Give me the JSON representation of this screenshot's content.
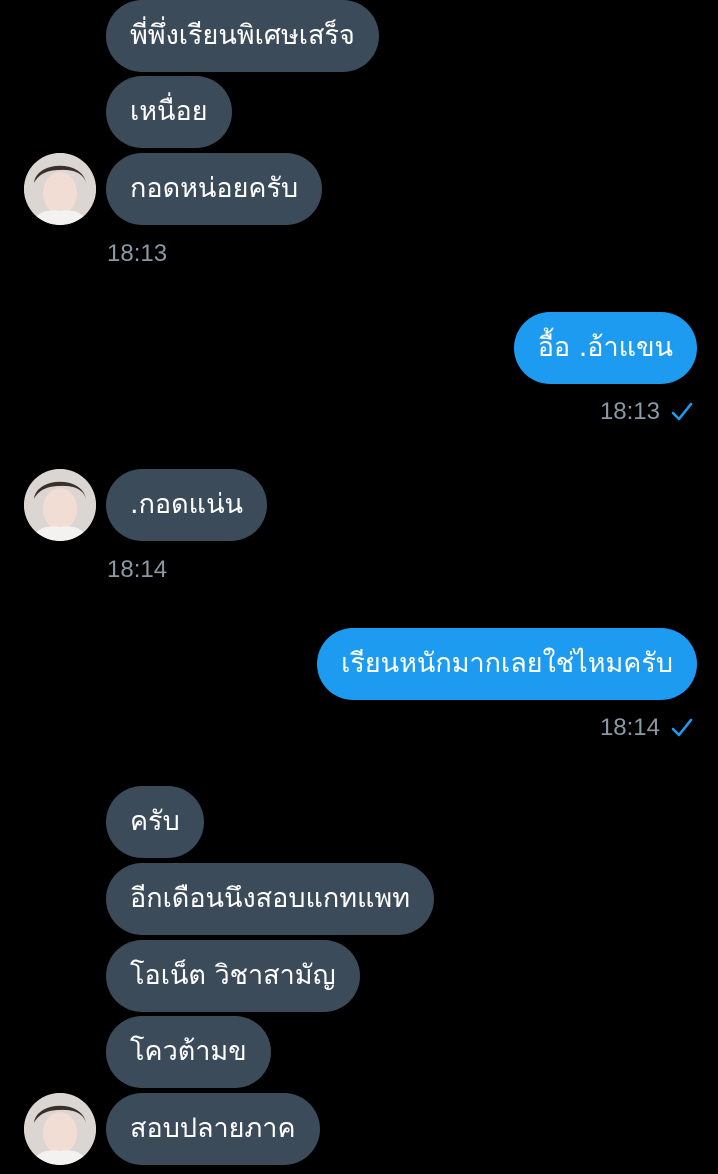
{
  "conversation": {
    "messages": [
      {
        "side": "in",
        "text": "พี่พึ่งเรียนพิเศษเสร็จ"
      },
      {
        "side": "in",
        "text": "เหนื่อย"
      },
      {
        "side": "in",
        "text": "กอดหน่อยครับ"
      },
      {
        "side": "out",
        "text": "อื้อ .อ้าแขน"
      },
      {
        "side": "in",
        "text": ".กอดแน่น"
      },
      {
        "side": "out",
        "text": "เรียนหนักมากเลยใช่ไหมครับ"
      },
      {
        "side": "in",
        "text": "ครับ"
      },
      {
        "side": "in",
        "text": "อีกเดือนนึงสอบแกทแพท"
      },
      {
        "side": "in",
        "text": "โอเน็ต วิชาสามัญ"
      },
      {
        "side": "in",
        "text": "โควต้ามข"
      },
      {
        "side": "in",
        "text": "สอบปลายภาค"
      }
    ],
    "timestamps": [
      "18:13",
      "18:13",
      "18:14",
      "18:14"
    ]
  },
  "colors": {
    "background": "#000000",
    "incoming_bubble": "#3c4b5a",
    "outgoing_bubble": "#1d9bf0",
    "timestamp": "#8b98a5",
    "read_check": "#1d9bf0"
  },
  "icons": {
    "read_receipt": "checkmark-icon",
    "avatar": "user-avatar-photo"
  }
}
